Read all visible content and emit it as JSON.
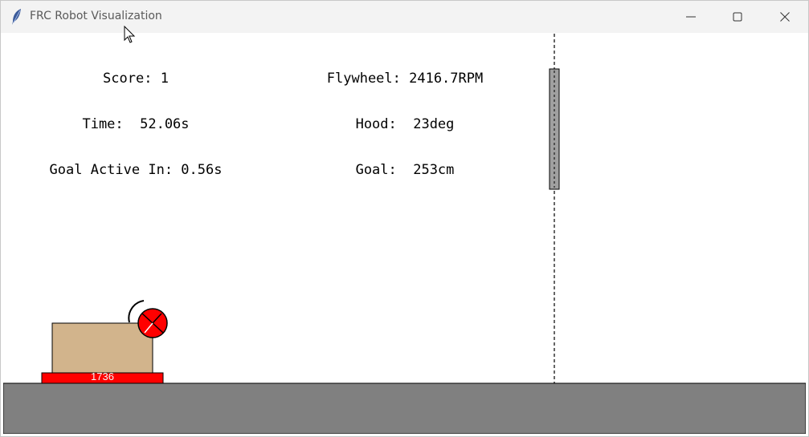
{
  "window": {
    "title": "FRC Robot Visualization",
    "icon": "feather-icon",
    "controls": [
      "minimize-icon",
      "maximize-icon",
      "close-icon"
    ]
  },
  "hud": {
    "score": "Score: 1",
    "time": "Time:  52.06s",
    "goal_active": "Goal Active In: 0.56s",
    "flywheel": "Flywheel: 2416.7RPM",
    "hood": "Hood:  23deg",
    "goal": "Goal:  253cm"
  },
  "robot": {
    "team_number": "1736",
    "body_color": "#d2b48c",
    "bumper_color": "#ff0000",
    "ball_color": "#ff0000"
  },
  "field": {
    "ground_color": "#808080",
    "goal_color": "#a0a0a0"
  }
}
